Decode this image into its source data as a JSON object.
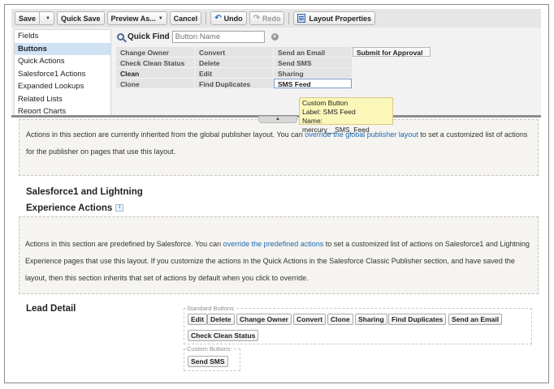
{
  "toolbar": {
    "save": "Save",
    "quick_save": "Quick Save",
    "preview_as": "Preview As...",
    "cancel": "Cancel",
    "undo": "Undo",
    "redo": "Redo",
    "layout_properties": "Layout Properties"
  },
  "palette": {
    "categories": [
      "Fields",
      "Buttons",
      "Quick Actions",
      "Salesforce1 Actions",
      "Expanded Lookups",
      "Related Lists",
      "Report Charts"
    ],
    "active_category": "Buttons",
    "quick_find": {
      "label": "Quick Find",
      "placeholder": "Button Name"
    },
    "buttons": [
      [
        "Change Owner",
        "Convert",
        "Send an Email",
        "Submit for Approval"
      ],
      [
        "Check Clean Status",
        "Delete",
        "Send SMS"
      ],
      [
        "Clean",
        "Edit",
        "Sharing"
      ],
      [
        "Clone",
        "Find Duplicates",
        "SMS Feed"
      ]
    ],
    "tooltip": {
      "title": "Custom Button",
      "label": "Label: SMS Feed",
      "name": "Name: mercury__SMS_Feed"
    }
  },
  "publisher_note": {
    "pre": "Actions in this section are currently inherited from the global publisher layout. You can ",
    "link": "override the global publisher layout",
    "post": " to set a customized list of actions for the publisher on pages that use this layout."
  },
  "sf1_section": {
    "title": "Salesforce1 and Lightning Experience Actions",
    "info": "i"
  },
  "sf1_note": {
    "pre": "Actions in this section are predefined by Salesforce. You can ",
    "link": "override the predefined actions",
    "post": " to set a customized list of actions on Salesforce1 and Lightning Experience pages that use this layout. If you customize the actions in the Quick Actions in the Salesforce Classic Publisher section, and have saved the layout, then this section inherits that set of actions by default when you click to override."
  },
  "lead_detail": {
    "title": "Lead Detail",
    "standard_label": "Standard Buttons",
    "standard_buttons": [
      "Edit",
      "Delete",
      "Change Owner",
      "Convert",
      "Clone",
      "Sharing",
      "Find Duplicates",
      "Send an Email",
      "Check Clean Status"
    ],
    "custom_label": "Custom Buttons",
    "custom_buttons": [
      "Send SMS"
    ]
  }
}
